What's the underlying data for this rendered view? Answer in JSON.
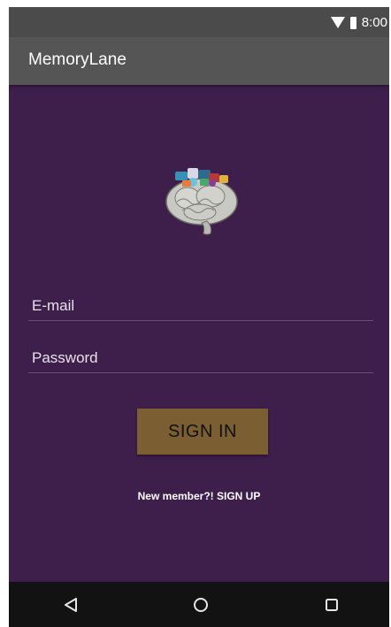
{
  "status_bar": {
    "time": "8:00",
    "icons": [
      "wifi-icon",
      "battery-icon"
    ]
  },
  "app_bar": {
    "title": "MemoryLane"
  },
  "logo": {
    "icon": "brain-logo-icon"
  },
  "form": {
    "email_placeholder": "E-mail",
    "email_value": "",
    "password_placeholder": "Password",
    "password_value": "",
    "sign_in_label": "SIGN IN",
    "signup_prompt": "New member?! ",
    "signup_link": "SIGN UP"
  },
  "nav_bar": {
    "icons": [
      "back-icon",
      "home-icon",
      "recents-icon"
    ]
  },
  "colors": {
    "background": "#3e1e4b",
    "app_bar": "#555555",
    "status_bar": "#4b4b4b",
    "button": "#7b5e32",
    "nav_bar": "#121212"
  }
}
